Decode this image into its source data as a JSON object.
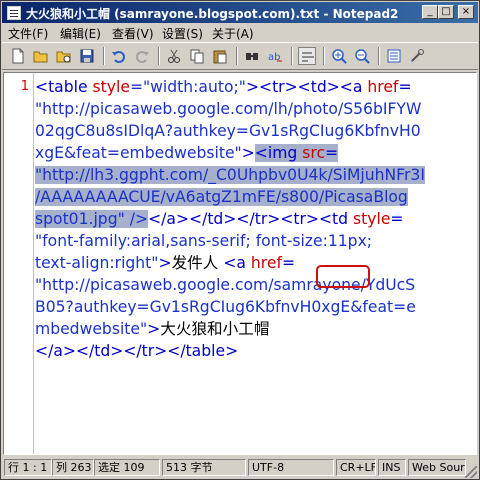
{
  "window": {
    "title": "大火狼和小工帽 (samrayone.blogspot.com).txt - Notepad2"
  },
  "title_buttons": {
    "minimize": "_",
    "maximize": "□",
    "close": "×"
  },
  "menu": {
    "items": [
      "文件(F)",
      "编辑(E)",
      "查看(V)",
      "设置(S)",
      "关于(A)"
    ]
  },
  "toolbar": {
    "buttons": [
      "new-file-icon",
      "open-folder-icon",
      "open-browse-icon",
      "save-icon",
      "undo-icon",
      "redo-icon",
      "cut-icon",
      "copy-icon",
      "paste-icon",
      "find-icon",
      "replace-icon",
      "word-wrap-icon",
      "zoom-in-icon",
      "zoom-out-icon",
      "scheme-icon",
      "settings-icon"
    ]
  },
  "editor": {
    "line_number": "1",
    "lines": [
      [
        {
          "t": "<table ",
          "c": "tag"
        },
        {
          "t": "style",
          "c": "attr"
        },
        {
          "t": "=\"width:auto;\"",
          "c": "str"
        },
        {
          "t": "><tr><td><a ",
          "c": "tag"
        },
        {
          "t": "href",
          "c": "attr"
        },
        {
          "t": "=",
          "c": "tag"
        }
      ],
      [
        {
          "t": "\"http://picasaweb.google.com/lh/photo/S56bIFYW",
          "c": "str"
        }
      ],
      [
        {
          "t": "02qgC8u8sIDlqA?authkey=Gv1sRgCIug6KbfnvH0",
          "c": "str"
        }
      ],
      [
        {
          "t": "xgE&feat=embedwebsite\"",
          "c": "str"
        },
        {
          "t": ">",
          "c": "tag"
        },
        {
          "t": "<img ",
          "c": "tag",
          "s": 1
        },
        {
          "t": "src",
          "c": "attr",
          "s": 1
        },
        {
          "t": "=",
          "c": "tag",
          "s": 1
        }
      ],
      [
        {
          "t": "\"http://lh3.ggpht.com/_C0Uhpbv0U4k/SiMjuhNFr3I",
          "c": "str",
          "s": 1
        }
      ],
      [
        {
          "t": "/AAAAAAAACUE/vA6atgZ1mFE/s800/PicasaBlog",
          "c": "str",
          "s": 1
        }
      ],
      [
        {
          "t": "spot01.jpg\" />",
          "c": "str",
          "s": 1
        },
        {
          "t": "</a></td></tr><tr><td ",
          "c": "tag"
        },
        {
          "t": "style",
          "c": "attr"
        },
        {
          "t": "=",
          "c": "tag"
        }
      ],
      [
        {
          "t": "\"font-family:arial,sans-serif; font-size:11px;",
          "c": "str"
        }
      ],
      [
        {
          "t": "text-align:right\"",
          "c": "str"
        },
        {
          "t": ">",
          "c": "tag"
        },
        {
          "t": "发件人 ",
          "c": "txt"
        },
        {
          "t": "<a ",
          "c": "tag"
        },
        {
          "t": "href",
          "c": "attr"
        },
        {
          "t": "=",
          "c": "tag"
        }
      ],
      [
        {
          "t": "\"http://picasaweb.google.com/samrayone/YdUcS",
          "c": "str"
        }
      ],
      [
        {
          "t": "B05?authkey=Gv1sRgCIug6KbfnvH0xgE&feat=e",
          "c": "str"
        }
      ],
      [
        {
          "t": "mbedwebsite\"",
          "c": "str"
        },
        {
          "t": ">",
          "c": "tag"
        },
        {
          "t": "大火狼和小工帽",
          "c": "txt"
        }
      ],
      [
        {
          "t": "</a></td></tr></table>",
          "c": "tag"
        }
      ]
    ]
  },
  "status": {
    "position": "行 1 : 1",
    "column": "列 263",
    "selection": "选定 109",
    "size": "513 字节",
    "encoding": "UTF-8",
    "eol": "CR+LF",
    "ins": "INS",
    "scheme": "Web Source"
  }
}
